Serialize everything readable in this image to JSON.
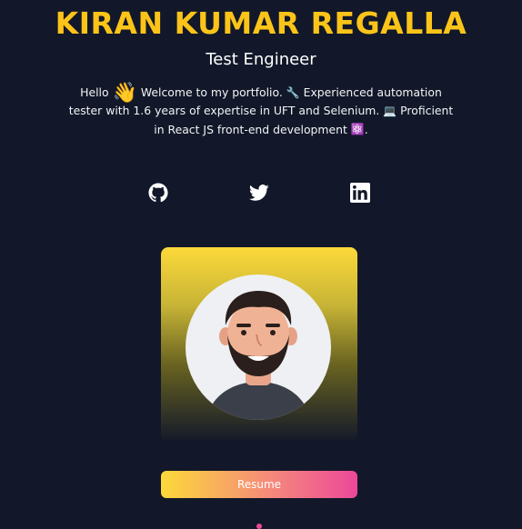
{
  "hero": {
    "name": "KIRAN KUMAR REGALLA",
    "role": "Test Engineer"
  },
  "intro": {
    "part1": "Hello",
    "wave_emoji": "👋",
    "part2": "Welcome to my portfolio.",
    "wrench_emoji": "🔧",
    "part3": "Experienced automation tester with 1.6 years of expertise in UFT and Selenium.",
    "laptop_emoji": "💻",
    "part4": "Proficient in React JS front-end development",
    "atom_emoji": "⚛️",
    "part5": "."
  },
  "socials": [
    {
      "icon": "github-icon"
    },
    {
      "icon": "twitter-icon"
    },
    {
      "icon": "linkedin-icon"
    }
  ],
  "resume": {
    "label": "Resume"
  },
  "colors": {
    "background": "#121829",
    "accent_yellow": "#fcc419",
    "accent_pink": "#ec4899"
  }
}
